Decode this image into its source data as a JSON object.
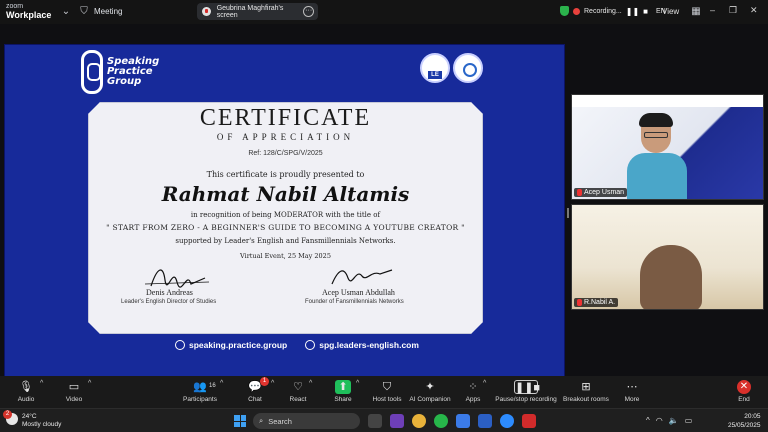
{
  "titlebar": {
    "brand_top": "zoom",
    "brand_bottom": "Workplace",
    "meeting_label": "Meeting",
    "shared_screen": "Geubrina Maghfirah's screen",
    "recording_label": "Recording...",
    "language": "EN",
    "view_label": "View"
  },
  "certificate": {
    "logo_text": [
      "Speaking",
      "Practice",
      "Group"
    ],
    "title": "CERTIFICATE",
    "subtitle": "OF APPRECIATION",
    "ref": "Ref: 128/C/SPG/V/2025",
    "presented_line": "This certificate is proudly presented to",
    "recipient": "Rahmat Nabil Altamis",
    "recognition_line": "in recognition of being MODERATOR with the title of",
    "topic": "\" START FROM ZERO - A BEGINNER'S GUIDE TO BECOMING A YOUTUBE CREATOR \"",
    "support_line": "supported by Leader's English and Fansmillennials Networks.",
    "event_line": "Virtual Event, 25 May 2025",
    "signatories": [
      {
        "name": "Denis Andreas",
        "role": "Leader's English Director of Studies"
      },
      {
        "name": "Acep Usman Abdullah",
        "role": "Founder of Fansmillennials Networks"
      }
    ],
    "footer_links": [
      "speaking.practice.group",
      "spg.leaders-english.com"
    ]
  },
  "participants": [
    {
      "name": "Acep Usman",
      "muted": true
    },
    {
      "name": "R.Nabil A.",
      "muted": true
    }
  ],
  "toolbar": {
    "audio": "Audio",
    "video": "Video",
    "participants": "Participants",
    "participants_count": "16",
    "chat": "Chat",
    "chat_badge": "1",
    "react": "React",
    "share": "Share",
    "host_tools": "Host tools",
    "ai_companion": "AI Companion",
    "apps": "Apps",
    "recording": "Pause/stop recording",
    "breakout": "Breakout rooms",
    "more": "More",
    "end": "End"
  },
  "taskbar": {
    "weather_badge": "2",
    "temperature": "24°C",
    "weather": "Mostly cloudy",
    "search_placeholder": "Search",
    "time": "20:05",
    "date": "25/05/2025"
  },
  "colors": {
    "certificate_bg": "#172a9a",
    "share_green": "#1fbf5b",
    "end_red": "#d9302b"
  }
}
